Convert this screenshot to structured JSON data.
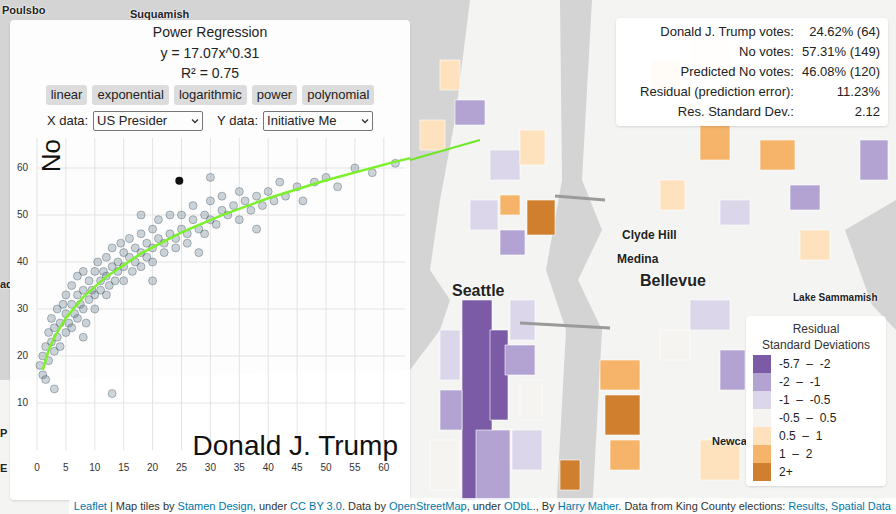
{
  "map": {
    "labels": [
      {
        "text": "Poulsbo"
      },
      {
        "text": "Suquamish"
      },
      {
        "text": "ad"
      },
      {
        "text": "P"
      },
      {
        "text": "E"
      },
      {
        "text": "Seattle"
      },
      {
        "text": "Clyde Hill"
      },
      {
        "text": "Medina"
      },
      {
        "text": "Bellevue"
      },
      {
        "text": "Lake Sammamish"
      },
      {
        "text": "Newca"
      }
    ]
  },
  "precinct_bins": [
    0,
    0,
    1,
    2,
    1,
    3,
    2,
    2,
    1,
    3,
    4,
    1,
    2,
    4,
    2,
    1,
    4,
    5,
    6,
    5,
    4,
    5,
    4,
    2,
    5,
    4,
    4,
    2,
    1,
    3,
    5,
    6,
    6,
    5,
    4,
    1,
    1
  ],
  "regression_panel": {
    "title": "Power Regression",
    "equation": "y = 17.07x^0.31",
    "r_squared": "R² = 0.75",
    "buttons": [
      "linear",
      "exponential",
      "logarithmic",
      "power",
      "polynomial"
    ],
    "x_select": {
      "label": "X data:",
      "value": "US Presider"
    },
    "y_select": {
      "label": "Y data:",
      "value": "Initiative Me"
    }
  },
  "chart": {
    "y_axis_label": "No",
    "x_axis_label": "Donald J. Trump",
    "x_ticks": [
      "0",
      "5",
      "10",
      "15",
      "20",
      "25",
      "30",
      "35",
      "40",
      "45",
      "50",
      "55",
      "60"
    ],
    "y_ticks": [
      "10",
      "20",
      "30",
      "40",
      "50",
      "60"
    ],
    "points": [
      [
        0.5,
        18
      ],
      [
        1,
        20
      ],
      [
        1,
        16
      ],
      [
        1.5,
        22
      ],
      [
        1.5,
        15
      ],
      [
        2,
        25
      ],
      [
        2,
        19
      ],
      [
        2.5,
        23
      ],
      [
        2.5,
        28
      ],
      [
        3,
        21
      ],
      [
        3,
        26
      ],
      [
        3.5,
        30
      ],
      [
        3.5,
        24
      ],
      [
        4,
        27
      ],
      [
        4,
        22
      ],
      [
        4.5,
        31
      ],
      [
        5,
        29
      ],
      [
        5,
        25
      ],
      [
        5,
        33
      ],
      [
        5.5,
        27
      ],
      [
        6,
        31
      ],
      [
        6,
        35
      ],
      [
        6,
        26
      ],
      [
        6.5,
        29
      ],
      [
        7,
        33
      ],
      [
        7,
        28
      ],
      [
        7,
        37
      ],
      [
        7.5,
        31
      ],
      [
        8,
        34
      ],
      [
        8,
        30
      ],
      [
        8,
        38
      ],
      [
        8.5,
        27
      ],
      [
        9,
        36
      ],
      [
        9,
        32
      ],
      [
        9.5,
        34
      ],
      [
        10,
        38
      ],
      [
        10,
        33
      ],
      [
        10,
        30
      ],
      [
        10.5,
        40
      ],
      [
        11,
        36
      ],
      [
        11,
        34
      ],
      [
        11.5,
        38
      ],
      [
        12,
        37
      ],
      [
        12,
        41
      ],
      [
        12,
        33
      ],
      [
        12.5,
        35
      ],
      [
        13,
        39
      ],
      [
        13,
        43
      ],
      [
        13.5,
        36
      ],
      [
        14,
        40
      ],
      [
        14,
        38
      ],
      [
        14.5,
        44
      ],
      [
        15,
        39
      ],
      [
        15,
        42
      ],
      [
        15,
        36
      ],
      [
        16,
        41
      ],
      [
        16,
        45
      ],
      [
        16.5,
        38
      ],
      [
        17,
        43
      ],
      [
        17,
        40
      ],
      [
        18,
        42
      ],
      [
        18,
        46
      ],
      [
        18,
        39
      ],
      [
        19,
        44
      ],
      [
        19,
        41
      ],
      [
        20,
        43
      ],
      [
        20,
        47
      ],
      [
        20,
        40
      ],
      [
        21,
        45
      ],
      [
        21,
        49
      ],
      [
        22,
        44
      ],
      [
        22,
        42
      ],
      [
        23,
        46
      ],
      [
        23,
        50
      ],
      [
        24,
        45
      ],
      [
        24,
        43
      ],
      [
        25,
        47
      ],
      [
        25,
        50
      ],
      [
        26,
        46
      ],
      [
        26,
        44
      ],
      [
        27,
        49
      ],
      [
        27,
        52
      ],
      [
        28,
        47
      ],
      [
        29,
        50
      ],
      [
        29,
        46
      ],
      [
        30,
        49
      ],
      [
        30,
        53
      ],
      [
        31,
        48
      ],
      [
        32,
        51
      ],
      [
        32,
        54
      ],
      [
        33,
        50
      ],
      [
        34,
        52
      ],
      [
        35,
        49
      ],
      [
        35,
        55
      ],
      [
        36,
        53
      ],
      [
        37,
        51
      ],
      [
        38,
        54
      ],
      [
        39,
        52
      ],
      [
        40,
        55
      ],
      [
        41,
        53
      ],
      [
        42,
        57
      ],
      [
        43,
        54
      ],
      [
        45,
        56
      ],
      [
        46,
        53
      ],
      [
        48,
        57
      ],
      [
        50,
        58
      ],
      [
        52,
        56
      ],
      [
        55,
        60
      ],
      [
        58,
        59
      ],
      [
        62,
        61
      ],
      [
        13,
        12
      ],
      [
        3,
        13
      ],
      [
        20,
        36
      ],
      [
        28,
        42
      ],
      [
        38,
        47
      ],
      [
        18,
        50
      ],
      [
        8,
        24
      ],
      [
        30,
        58
      ]
    ],
    "highlighted_point": [
      24.62,
      57.31
    ],
    "fit_curve": [
      [
        1,
        17.07
      ],
      [
        2,
        21.16
      ],
      [
        3,
        24.0
      ],
      [
        5,
        28.11
      ],
      [
        8,
        32.52
      ],
      [
        12,
        36.88
      ],
      [
        18,
        41.82
      ],
      [
        25,
        46.3
      ],
      [
        32,
        49.98
      ],
      [
        40,
        53.56
      ],
      [
        50,
        57.4
      ],
      [
        62,
        61.36
      ],
      [
        66,
        62.5
      ]
    ]
  },
  "info_box": {
    "rows": [
      {
        "label": "Donald J. Trump votes:",
        "value": "24.62% (64)"
      },
      {
        "label": "No votes:",
        "value": "57.31% (149)"
      },
      {
        "label": "Predicted No votes:",
        "value": "46.08% (120)"
      },
      {
        "label": "Residual (prediction error):",
        "value": "11.23%"
      },
      {
        "label": "Res. Standard Dev.:",
        "value": "2.12"
      }
    ]
  },
  "legend": {
    "title": [
      "Residual",
      "Standard Deviations"
    ],
    "items": [
      {
        "label": "-5.7  –  -2",
        "color": "#7b5aa6"
      },
      {
        "label": "-2  –  -1",
        "color": "#b2a3d3"
      },
      {
        "label": "-1  –  -0.5",
        "color": "#dcd6ea"
      },
      {
        "label": "-0.5  –  0.5",
        "color": "#f6f4f1"
      },
      {
        "label": "0.5  –  1",
        "color": "#fde2bd"
      },
      {
        "label": "1  –  2",
        "color": "#f5b46a"
      },
      {
        "label": "2+",
        "color": "#cf7f2e"
      }
    ]
  },
  "attribution": [
    {
      "text": "Leaflet",
      "link": true
    },
    {
      "text": " | Map tiles by ",
      "link": false
    },
    {
      "text": "Stamen Design",
      "link": true
    },
    {
      "text": ", under ",
      "link": false
    },
    {
      "text": "CC BY 3.0",
      "link": true
    },
    {
      "text": ". Data by ",
      "link": false
    },
    {
      "text": "OpenStreetMap",
      "link": true
    },
    {
      "text": ", under ",
      "link": false
    },
    {
      "text": "ODbL",
      "link": true
    },
    {
      "text": "., By ",
      "link": false
    },
    {
      "text": "Harry Maher",
      "link": true
    },
    {
      "text": ". Data from King County elections: ",
      "link": false
    },
    {
      "text": "Results",
      "link": true
    },
    {
      "text": ", ",
      "link": false
    },
    {
      "text": "Spatial Data",
      "link": true
    }
  ]
}
